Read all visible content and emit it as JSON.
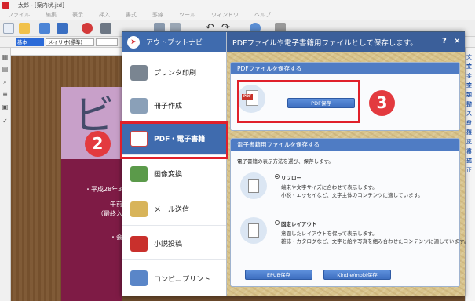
{
  "window": {
    "title": "一太郎 - [案内状.jtd]",
    "menu": [
      "ファイル",
      "編集",
      "表示",
      "挿入",
      "書式",
      "罫線",
      "ツール",
      "ウィンドウ",
      "ヘルプ"
    ],
    "style_value": "基本",
    "font_value": "メイリオ(標準)"
  },
  "document": {
    "big_char": "ビ",
    "lines": [
      "・平成28年3月",
      "午前",
      "（最終入場",
      "・会"
    ]
  },
  "right_strip": [
    "文字",
    "文字",
    "文字",
    "文字",
    "調整",
    "挿入",
    "スタ",
    "段落",
    "校正",
    "文章",
    "書式",
    "校正"
  ],
  "dialog": {
    "nav_title": "アウトプットナビ",
    "nav_items": [
      {
        "label": "プリンタ印刷",
        "icon": "printer-icon",
        "color": "#7a8591"
      },
      {
        "label": "冊子作成",
        "icon": "booklet-icon",
        "color": "#8aa0b8"
      },
      {
        "label": "PDF・電子書籍",
        "icon": "pdf-ebook-icon",
        "color": "#ffffff"
      },
      {
        "label": "画像変換",
        "icon": "image-convert-icon",
        "color": "#5b9a4a"
      },
      {
        "label": "メール送信",
        "icon": "mail-icon",
        "color": "#d8b45a"
      },
      {
        "label": "小説投稿",
        "icon": "novel-post-icon",
        "color": "#c9302c"
      },
      {
        "label": "コンビニプリント",
        "icon": "convenience-print-icon",
        "color": "#5a86c8"
      }
    ],
    "header_text": "PDFファイルや電子書籍用ファイルとして保存します。",
    "help_label": "?",
    "close_label": "×",
    "pdf_panel": {
      "title": "PDFファイルを保存する",
      "pdf_tag": "PDF",
      "button": "PDF保存"
    },
    "ebook_panel": {
      "title": "電子書籍用ファイルを保存する",
      "intro": "電子書籍の表示方法を選び、保存します。",
      "reflow_title": "リフロー",
      "reflow_desc1": "端末や文字サイズに合わせて表示します。",
      "reflow_desc2": "小説・エッセイなど、文字主体のコンテンツに適しています。",
      "fixed_title": "固定レイアウト",
      "fixed_desc1": "意図したレイアウトを保って表示します。",
      "fixed_desc2": "雑誌・カタログなど、文字と絵や写真を組み合わせたコンテンツに適しています。",
      "epub_button": "EPUB保存",
      "kindle_button": "Kindle/mobi保存"
    }
  },
  "annotations": {
    "step2": "2",
    "step3": "3"
  },
  "colors": {
    "accent": "#3f6bae",
    "annotation": "#e0202a"
  }
}
